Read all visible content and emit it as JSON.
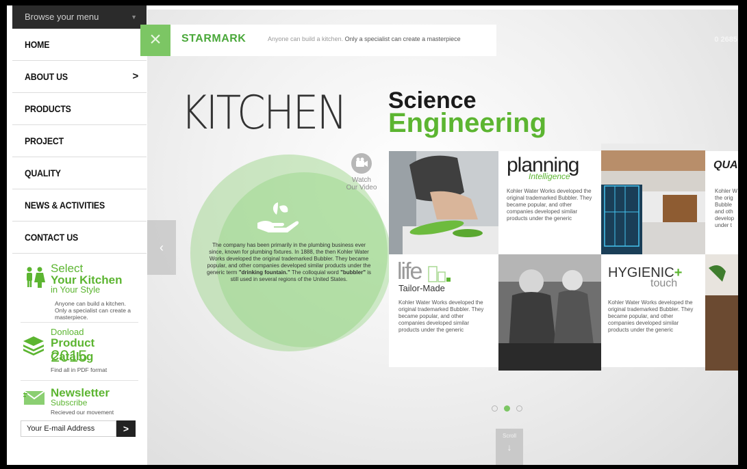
{
  "sidebar": {
    "browse_label": "Browse your menu",
    "nav": [
      {
        "label": "HOME"
      },
      {
        "label": "ABOUT US",
        "arrow": ">"
      },
      {
        "label": "PRODUCTS"
      },
      {
        "label": "PROJECT"
      },
      {
        "label": "QUALITY"
      },
      {
        "label": "NEWS & ACTIVITIES"
      },
      {
        "label": "CONTACT US"
      }
    ],
    "promo_kitchen": {
      "line1": "Select",
      "line2": "Your Kitchen",
      "line3": "in Your Style",
      "desc": "Anyone can build a kitchen. Only a specialist can create a masterpiece."
    },
    "promo_catalog": {
      "line1": "Donload",
      "line2": "Product Catalog",
      "line3": "2015",
      "desc": "Find all in PDF format"
    },
    "promo_newsletter": {
      "line1": "Newsletter",
      "line2": "Subscribe",
      "desc": "Recieved our movement"
    },
    "email": {
      "placeholder": "Your E-mail Address",
      "button": ">"
    }
  },
  "topbar": {
    "close": "×",
    "brand": "STARMARK",
    "tagline_plain": "Anyone can build a kitchen.",
    "tagline_bold": "Only a specialist can create a masterpiece",
    "phone": "0 2685"
  },
  "headline": {
    "kitchen": "KITCHEN",
    "science": "Science",
    "engineering": "Engineering"
  },
  "video": {
    "line1": "Watch",
    "line2": "Our Video"
  },
  "about": {
    "text": "The company has been primarily in the plumbing business ever since, known for plumbing fixtures. In 1888, the then Kohler Water Works developed the original trademarked Bubbler. They became popular, and other companies developed similar products under the generic term \"drinking fountain.\" The colloquial word \"bubbler\" is still used in several regions of the United States."
  },
  "tiles": {
    "planning": {
      "title": "planning",
      "subtitle": "Intelligence",
      "text": "Kohler Water Works developed the original trademarked Bubbler. They became popular, and other companies developed similar products under the generic"
    },
    "quality": {
      "title": "QUA",
      "text": "Kohler W the orig Bubble and oth develop under t"
    },
    "life": {
      "title": "life",
      "subtitle": "Tailor-Made",
      "text": "Kohler Water Works developed the original trademarked Bubbler. They became popular, and other companies developed similar products under the generic"
    },
    "hygienic": {
      "title": "HYGIENIC",
      "plus": "+",
      "subtitle": "touch",
      "text": "Kohler Water Works developed the original trademarked Bubbler. They became popular, and other companies developed similar products under the generic"
    }
  },
  "pager": {
    "count": 3,
    "active": 2
  },
  "scroll": {
    "label": "Scroll"
  },
  "prev": "‹",
  "colors": {
    "accent": "#5cb531",
    "dark": "#2b2b2b"
  }
}
